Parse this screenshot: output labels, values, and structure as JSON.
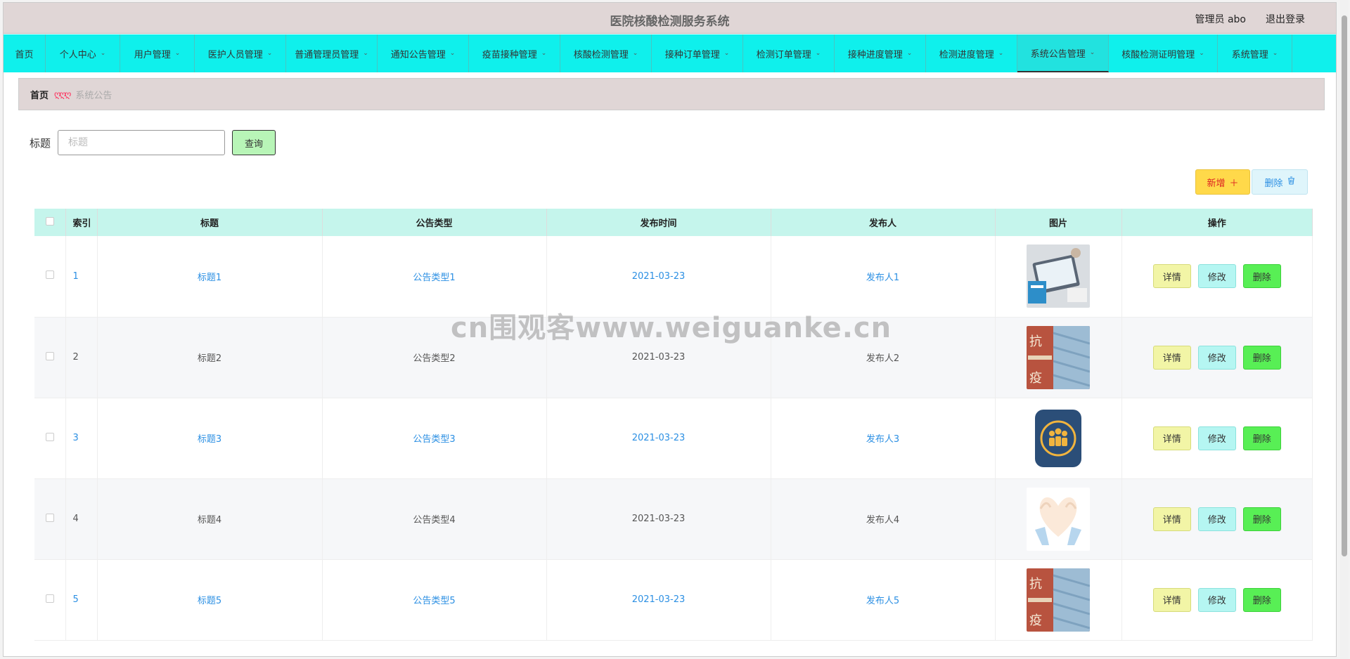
{
  "header": {
    "title": "医院核酸检测服务系统",
    "user": "管理员 abo",
    "logout": "退出登录"
  },
  "nav": [
    {
      "label": "首页",
      "dropdown": false,
      "w": 60
    },
    {
      "label": "个人中心",
      "dropdown": true,
      "w": 106
    },
    {
      "label": "用户管理",
      "dropdown": true,
      "w": 106
    },
    {
      "label": "医护人员管理",
      "dropdown": true,
      "w": 130
    },
    {
      "label": "普通管理员管理",
      "dropdown": true,
      "w": 130
    },
    {
      "label": "通知公告管理",
      "dropdown": true,
      "w": 130
    },
    {
      "label": "疫苗接种管理",
      "dropdown": true,
      "w": 130
    },
    {
      "label": "核酸检测管理",
      "dropdown": true,
      "w": 130
    },
    {
      "label": "接种订单管理",
      "dropdown": true,
      "w": 130
    },
    {
      "label": "检测订单管理",
      "dropdown": true,
      "w": 130
    },
    {
      "label": "接种进度管理",
      "dropdown": true,
      "w": 130
    },
    {
      "label": "检测进度管理",
      "dropdown": true,
      "w": 130
    },
    {
      "label": "系统公告管理",
      "dropdown": true,
      "w": 130,
      "active": true
    },
    {
      "label": "核酸检测证明管理",
      "dropdown": true,
      "w": 155
    },
    {
      "label": "系统管理",
      "dropdown": true,
      "w": 106
    }
  ],
  "breadcrumb": {
    "home": "首页",
    "separator": "ღღღ",
    "current": "系统公告"
  },
  "search": {
    "label": "标题",
    "placeholder": "标题",
    "button": "查询"
  },
  "toolbar": {
    "add": "新增",
    "delete": "删除"
  },
  "table": {
    "headers": [
      "索引",
      "标题",
      "公告类型",
      "发布时间",
      "发布人",
      "图片",
      "操作"
    ],
    "rows": [
      {
        "index": "1",
        "title": "标题1",
        "type": "公告类型1",
        "time": "2021-03-23",
        "publisher": "发布人1",
        "image": "laptop-medical-photo"
      },
      {
        "index": "2",
        "title": "标题2",
        "type": "公告类型2",
        "time": "2021-03-23",
        "publisher": "发布人2",
        "image": "masks-calligraphy-photo"
      },
      {
        "index": "3",
        "title": "标题3",
        "type": "公告类型3",
        "time": "2021-03-23",
        "publisher": "发布人3",
        "image": "people-badge-icon"
      },
      {
        "index": "4",
        "title": "标题4",
        "type": "公告类型4",
        "time": "2021-03-23",
        "publisher": "发布人4",
        "image": "heart-hands-illustration"
      },
      {
        "index": "5",
        "title": "标题5",
        "type": "公告类型5",
        "time": "2021-03-23",
        "publisher": "发布人5",
        "image": "masks-calligraphy-photo"
      }
    ],
    "row_buttons": {
      "detail": "详情",
      "edit": "修改",
      "remove": "删除"
    }
  },
  "watermark": "cn围观客www.weiguanke.cn",
  "colors": {
    "nav_bg": "#0ff0ec",
    "header_bg": "#e0d6d6",
    "table_header_bg": "#c5f5ec",
    "link": "#2b8fe3"
  }
}
